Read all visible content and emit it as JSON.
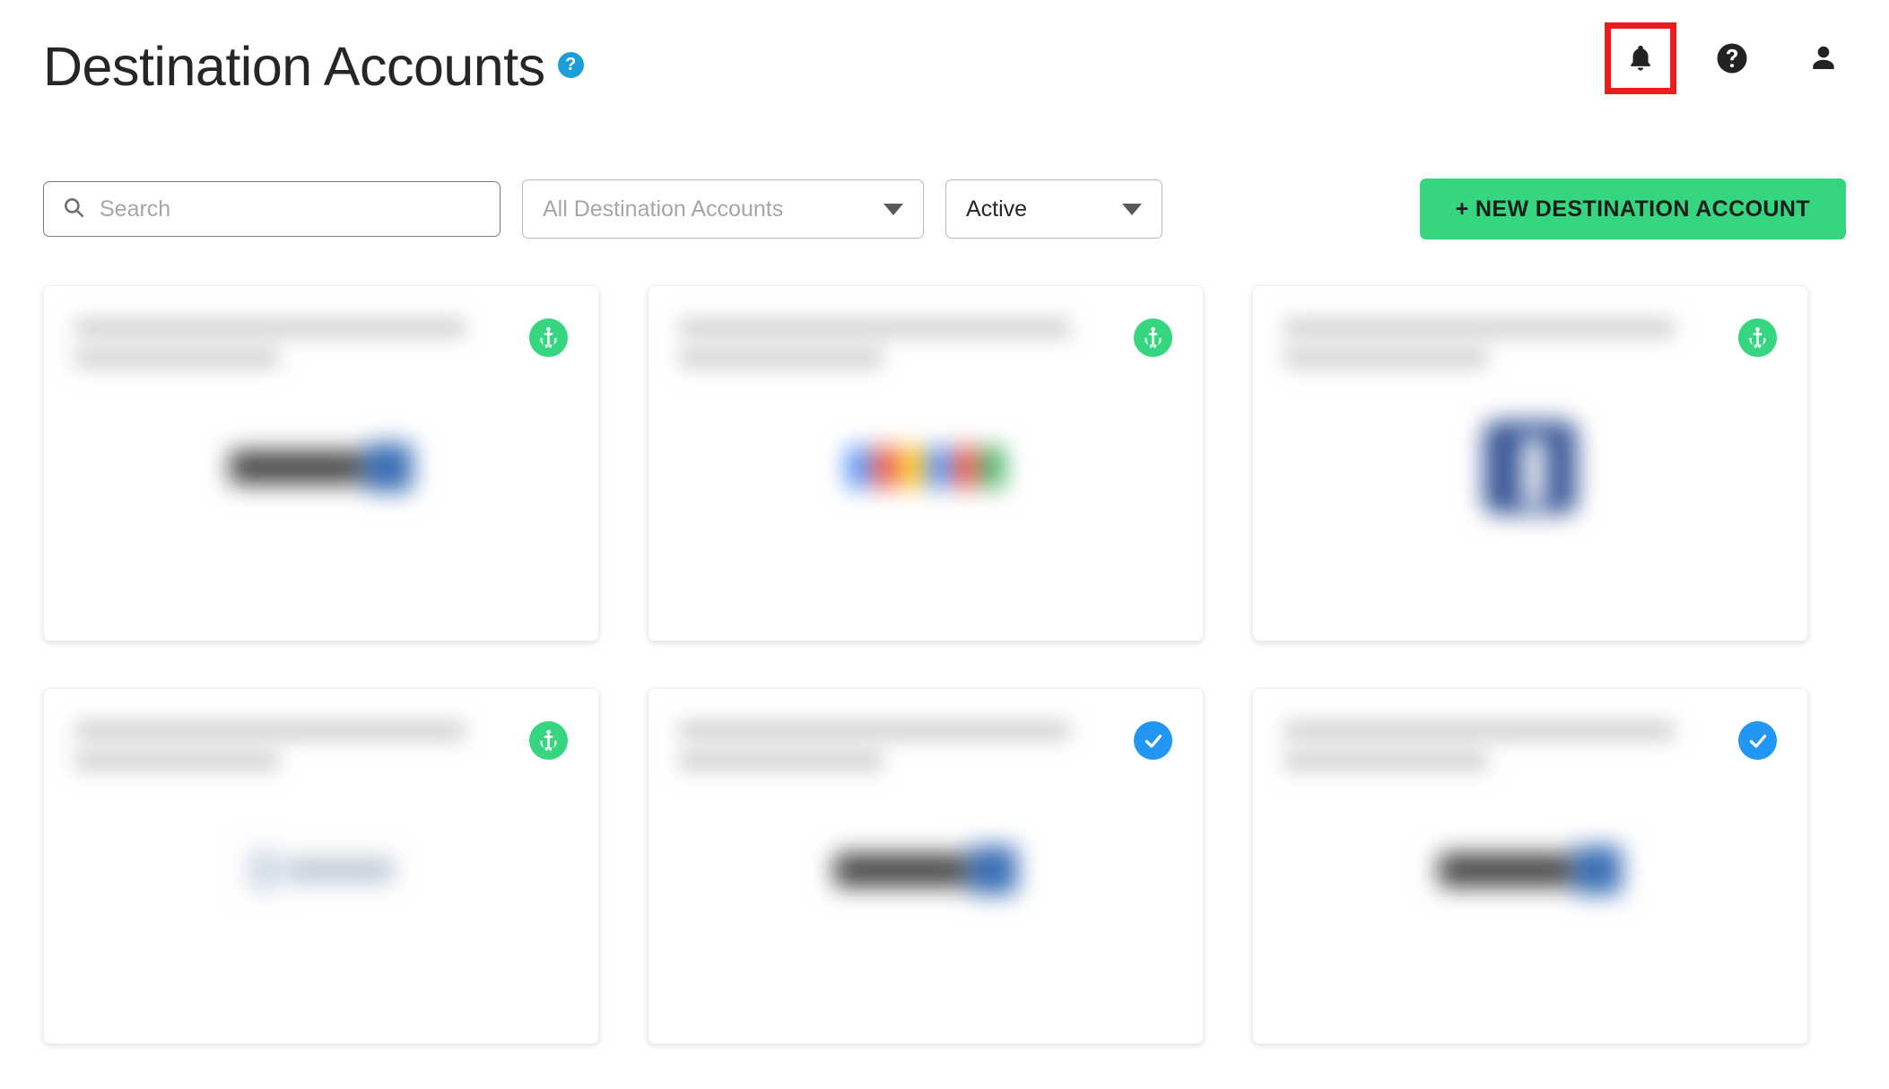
{
  "header": {
    "title": "Destination Accounts",
    "help_badge": "?",
    "icons": [
      {
        "name": "notifications-bell-icon",
        "label": "Notifications",
        "highlighted": true
      },
      {
        "name": "help-circle-icon",
        "label": "Help",
        "highlighted": false
      },
      {
        "name": "user-account-icon",
        "label": "Account",
        "highlighted": false
      }
    ],
    "highlight_color": "#ec1c1c"
  },
  "toolbar": {
    "search": {
      "value": "",
      "placeholder": "Search",
      "icon": "search-icon"
    },
    "account_filter": {
      "value": "All Destination Accounts",
      "is_placeholder": true,
      "icon": "chevron-down-icon"
    },
    "status_filter": {
      "value": "Active",
      "is_placeholder": false,
      "icon": "chevron-down-icon"
    },
    "new_button": {
      "label": "+ NEW DESTINATION ACCOUNT",
      "color": "#35d67f"
    }
  },
  "colors": {
    "accent_green": "#35d67f",
    "accent_blue": "#2196f3",
    "help_blue": "#1b9dd9",
    "highlight_red": "#ec1c1c",
    "title_text": "#262626"
  },
  "cards": [
    {
      "title_redacted": true,
      "badge": "anchor-icon",
      "badge_status": "needs-attention",
      "badge_color": "#35d67f",
      "logo": "linkedin-logo",
      "logo_redacted": true
    },
    {
      "title_redacted": true,
      "badge": "anchor-icon",
      "badge_status": "needs-attention",
      "badge_color": "#35d67f",
      "logo": "google-logo",
      "logo_redacted": true
    },
    {
      "title_redacted": true,
      "badge": "anchor-icon",
      "badge_status": "needs-attention",
      "badge_color": "#35d67f",
      "logo": "facebook-logo",
      "logo_redacted": true
    },
    {
      "title_redacted": true,
      "badge": "anchor-icon",
      "badge_status": "needs-attention",
      "badge_color": "#35d67f",
      "logo": "faint-logo",
      "logo_redacted": true
    },
    {
      "title_redacted": true,
      "badge": "check-circle-icon",
      "badge_status": "connected",
      "badge_color": "#2196f3",
      "logo": "linkedin-logo",
      "logo_redacted": true
    },
    {
      "title_redacted": true,
      "badge": "check-circle-icon",
      "badge_status": "connected",
      "badge_color": "#2196f3",
      "logo": "linkedin-logo",
      "logo_redacted": true
    }
  ]
}
